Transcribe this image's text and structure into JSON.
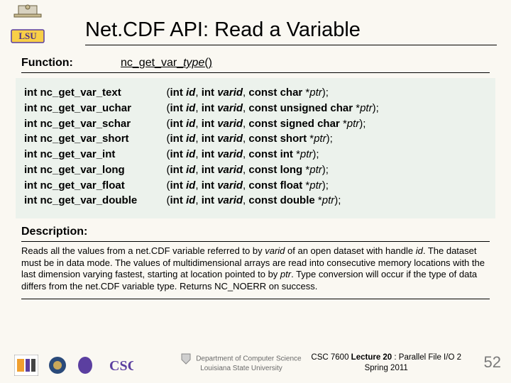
{
  "title": "Net.CDF API: Read a Variable",
  "function": {
    "label": "Function:",
    "name_prefix": "nc_get_var_",
    "name_ital": "type",
    "name_suffix": "()"
  },
  "signatures": [
    {
      "name": "nc_get_var_text",
      "type": "char"
    },
    {
      "name": "nc_get_var_uchar",
      "type": "unsigned char"
    },
    {
      "name": "nc_get_var_schar",
      "type": "signed char"
    },
    {
      "name": "nc_get_var_short",
      "type": "short"
    },
    {
      "name": "nc_get_var_int",
      "type": "int"
    },
    {
      "name": "nc_get_var_long",
      "type": "long"
    },
    {
      "name": "nc_get_var_float",
      "type": "float"
    },
    {
      "name": "nc_get_var_double",
      "type": "double"
    }
  ],
  "description": {
    "label": "Description:",
    "body_parts": [
      "Reads all the values from a net.CDF variable referred to by ",
      "varid",
      " of an open dataset with handle ",
      "id",
      ". The dataset must be in data mode. The values of multidimensional arrays are read into consecutive memory locations with the last dimension varying fastest, starting at location pointed to by ",
      "ptr",
      ". Type conversion will occur if the type of data differs from the net.CDF variable type. Returns NC_NOERR on success."
    ]
  },
  "footer": {
    "dept_line1": "Department of Computer Science",
    "dept_line2": "Louisiana State University",
    "course_line1_a": "CSC 7600 ",
    "course_line1_b": "Lecture 20",
    "course_line1_c": " : Parallel File I/O 2",
    "course_line2": "Spring 2011",
    "page": "52",
    "csc_label": "CSC"
  },
  "icons": {
    "lsu": "lsu-logo-icon",
    "cct": "cct-logo-icon",
    "nsf": "nsf-logo-icon",
    "csc": "csc-logo-icon",
    "shield": "dept-shield-icon"
  }
}
